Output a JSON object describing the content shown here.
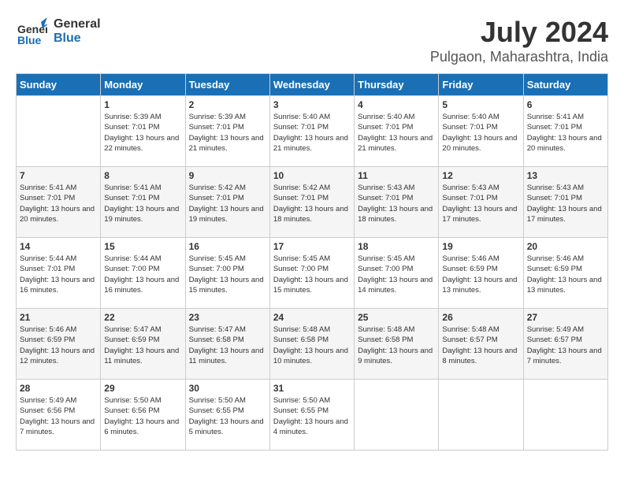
{
  "logo": {
    "part1": "General",
    "part2": "Blue"
  },
  "title": "July 2024",
  "subtitle": "Pulgaon, Maharashtra, India",
  "weekdays": [
    "Sunday",
    "Monday",
    "Tuesday",
    "Wednesday",
    "Thursday",
    "Friday",
    "Saturday"
  ],
  "weeks": [
    [
      {
        "day": "",
        "info": ""
      },
      {
        "day": "1",
        "info": "Sunrise: 5:39 AM\nSunset: 7:01 PM\nDaylight: 13 hours\nand 22 minutes."
      },
      {
        "day": "2",
        "info": "Sunrise: 5:39 AM\nSunset: 7:01 PM\nDaylight: 13 hours\nand 21 minutes."
      },
      {
        "day": "3",
        "info": "Sunrise: 5:40 AM\nSunset: 7:01 PM\nDaylight: 13 hours\nand 21 minutes."
      },
      {
        "day": "4",
        "info": "Sunrise: 5:40 AM\nSunset: 7:01 PM\nDaylight: 13 hours\nand 21 minutes."
      },
      {
        "day": "5",
        "info": "Sunrise: 5:40 AM\nSunset: 7:01 PM\nDaylight: 13 hours\nand 20 minutes."
      },
      {
        "day": "6",
        "info": "Sunrise: 5:41 AM\nSunset: 7:01 PM\nDaylight: 13 hours\nand 20 minutes."
      }
    ],
    [
      {
        "day": "7",
        "info": "Sunrise: 5:41 AM\nSunset: 7:01 PM\nDaylight: 13 hours\nand 20 minutes."
      },
      {
        "day": "8",
        "info": "Sunrise: 5:41 AM\nSunset: 7:01 PM\nDaylight: 13 hours\nand 19 minutes."
      },
      {
        "day": "9",
        "info": "Sunrise: 5:42 AM\nSunset: 7:01 PM\nDaylight: 13 hours\nand 19 minutes."
      },
      {
        "day": "10",
        "info": "Sunrise: 5:42 AM\nSunset: 7:01 PM\nDaylight: 13 hours\nand 18 minutes."
      },
      {
        "day": "11",
        "info": "Sunrise: 5:43 AM\nSunset: 7:01 PM\nDaylight: 13 hours\nand 18 minutes."
      },
      {
        "day": "12",
        "info": "Sunrise: 5:43 AM\nSunset: 7:01 PM\nDaylight: 13 hours\nand 17 minutes."
      },
      {
        "day": "13",
        "info": "Sunrise: 5:43 AM\nSunset: 7:01 PM\nDaylight: 13 hours\nand 17 minutes."
      }
    ],
    [
      {
        "day": "14",
        "info": "Sunrise: 5:44 AM\nSunset: 7:01 PM\nDaylight: 13 hours\nand 16 minutes."
      },
      {
        "day": "15",
        "info": "Sunrise: 5:44 AM\nSunset: 7:00 PM\nDaylight: 13 hours\nand 16 minutes."
      },
      {
        "day": "16",
        "info": "Sunrise: 5:45 AM\nSunset: 7:00 PM\nDaylight: 13 hours\nand 15 minutes."
      },
      {
        "day": "17",
        "info": "Sunrise: 5:45 AM\nSunset: 7:00 PM\nDaylight: 13 hours\nand 15 minutes."
      },
      {
        "day": "18",
        "info": "Sunrise: 5:45 AM\nSunset: 7:00 PM\nDaylight: 13 hours\nand 14 minutes."
      },
      {
        "day": "19",
        "info": "Sunrise: 5:46 AM\nSunset: 6:59 PM\nDaylight: 13 hours\nand 13 minutes."
      },
      {
        "day": "20",
        "info": "Sunrise: 5:46 AM\nSunset: 6:59 PM\nDaylight: 13 hours\nand 13 minutes."
      }
    ],
    [
      {
        "day": "21",
        "info": "Sunrise: 5:46 AM\nSunset: 6:59 PM\nDaylight: 13 hours\nand 12 minutes."
      },
      {
        "day": "22",
        "info": "Sunrise: 5:47 AM\nSunset: 6:59 PM\nDaylight: 13 hours\nand 11 minutes."
      },
      {
        "day": "23",
        "info": "Sunrise: 5:47 AM\nSunset: 6:58 PM\nDaylight: 13 hours\nand 11 minutes."
      },
      {
        "day": "24",
        "info": "Sunrise: 5:48 AM\nSunset: 6:58 PM\nDaylight: 13 hours\nand 10 minutes."
      },
      {
        "day": "25",
        "info": "Sunrise: 5:48 AM\nSunset: 6:58 PM\nDaylight: 13 hours\nand 9 minutes."
      },
      {
        "day": "26",
        "info": "Sunrise: 5:48 AM\nSunset: 6:57 PM\nDaylight: 13 hours\nand 8 minutes."
      },
      {
        "day": "27",
        "info": "Sunrise: 5:49 AM\nSunset: 6:57 PM\nDaylight: 13 hours\nand 7 minutes."
      }
    ],
    [
      {
        "day": "28",
        "info": "Sunrise: 5:49 AM\nSunset: 6:56 PM\nDaylight: 13 hours\nand 7 minutes."
      },
      {
        "day": "29",
        "info": "Sunrise: 5:50 AM\nSunset: 6:56 PM\nDaylight: 13 hours\nand 6 minutes."
      },
      {
        "day": "30",
        "info": "Sunrise: 5:50 AM\nSunset: 6:55 PM\nDaylight: 13 hours\nand 5 minutes."
      },
      {
        "day": "31",
        "info": "Sunrise: 5:50 AM\nSunset: 6:55 PM\nDaylight: 13 hours\nand 4 minutes."
      },
      {
        "day": "",
        "info": ""
      },
      {
        "day": "",
        "info": ""
      },
      {
        "day": "",
        "info": ""
      }
    ]
  ]
}
